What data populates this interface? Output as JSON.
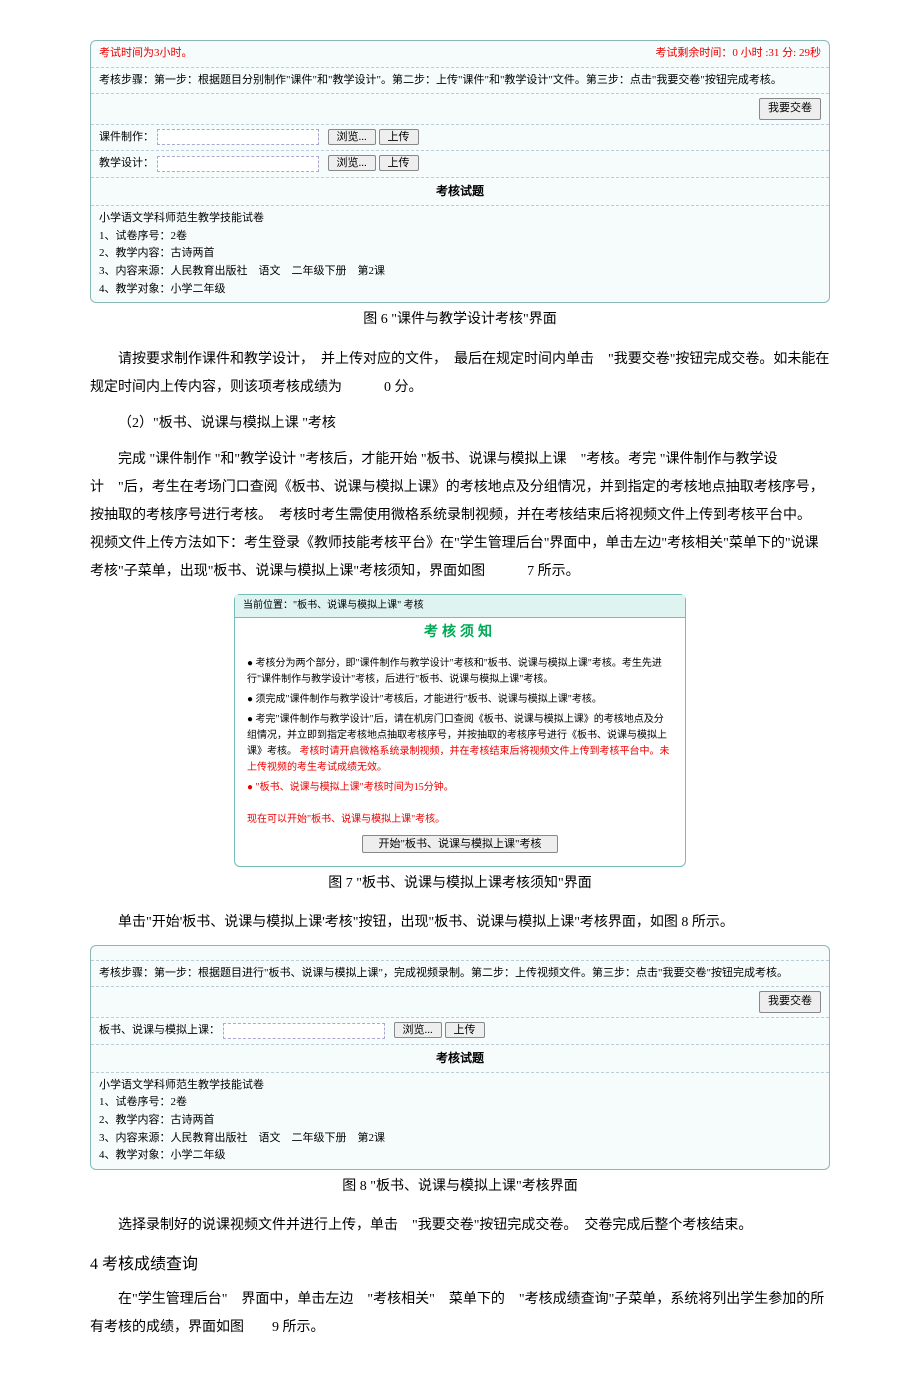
{
  "fig6": {
    "timer_left": "考试时间为3小时。",
    "timer_right": "考试剩余时间：0 小时 :31 分: 29秒",
    "steps": "考核步骤：第一步：根据题目分别制作\"课件\"和\"教学设计\"。第二步：上传\"课件\"和\"教学设计\"文件。第三步：点击\"我要交卷\"按钮完成考核。",
    "submit": "我要交卷",
    "row1_label": "课件制作：",
    "row2_label": "教学设计：",
    "browse": "浏览...",
    "upload": "上传",
    "section": "考核试题",
    "papertitle": "小学语文学科师范生教学技能试卷",
    "i1": "1、试卷序号：2卷",
    "i2": "2、教学内容：古诗两首",
    "i3": "3、内容来源：人民教育出版社　语文　二年级下册　第2课",
    "i4": "4、教学对象：小学二年级",
    "caption": "图 6 \"课件与教学设计考核\"界面"
  },
  "p1": "请按要求制作课件和教学设计，　并上传对应的文件，　最后在规定时间内单击　\"我要交卷\"按钮完成交卷。如未能在规定时间内上传内容，则该项考核成绩为　　　0 分。",
  "p2_label": "（2）\"板书、说课与模拟上课 \"考核",
  "p3": "完成 \"课件制作 \"和\"教学设计 \"考核后，才能开始 \"板书、说课与模拟上课　\"考核。考完 \"课件制作与教学设计　\"后，考生在考场门口查阅《板书、说课与模拟上课》的考核地点及分组情况，并到指定的考核地点抽取考核序号，　按抽取的考核序号进行考核。　考核时考生需使用微格系统录制视频，并在考核结束后将视频文件上传到考核平台中。　视频文件上传方法如下：考生登录《教师技能考核平台》在\"学生管理后台\"界面中，单击左边\"考核相关\"菜单下的\"说课考核\"子菜单，出现\"板书、说课与模拟上课\"考核须知，界面如图　　　7 所示。",
  "fig7": {
    "head": "当前位置：\"板书、说课与模拟上课\" 考核",
    "title": "考核须知",
    "b1": "● 考核分为两个部分，即\"课件制作与教学设计\"考核和\"板书、说课与模拟上课\"考核。考生先进行\"课件制作与教学设计\"考核，后进行\"板书、说课与模拟上课\"考核。",
    "b2": "● 须完成\"课件制作与教学设计\"考核后，才能进行\"板书、说课与模拟上课\"考核。",
    "b3a": "● 考完\"课件制作与教学设计\"后，请在机房门口查阅《板书、说课与模拟上课》的考核地点及分组情况，并立即到指定考核地点抽取考核序号，并按抽取的考核序号进行《板书、说课与模拟上课》考核。",
    "b3b": "考核时请开启微格系统录制视频，并在考核结束后将视频文件上传到考核平台中。未上传视频的考生考试成绩无效。",
    "b4": "● \"板书、说课与模拟上课\"考核时间为15分钟。",
    "ready": "现在可以开始\"板书、说课与模拟上课\"考核。",
    "btn": "开始\"板书、说课与模拟上课\"考核",
    "caption": "图 7 \"板书、说课与模拟上课考核须知\"界面"
  },
  "p4": "单击\"开始'板书、说课与模拟上课'考核\"按钮，出现\"板书、说课与模拟上课\"考核界面，如图 8 所示。",
  "fig8": {
    "steps": "考核步骤：第一步：根据题目进行\"板书、说课与模拟上课\"，完成视频录制。第二步：上传视频文件。第三步：点击\"我要交卷\"按钮完成考核。",
    "submit": "我要交卷",
    "row_label": "板书、说课与模拟上课：",
    "browse": "浏览...",
    "upload": "上传",
    "section": "考核试题",
    "papertitle": "小学语文学科师范生教学技能试卷",
    "i1": "1、试卷序号：2卷",
    "i2": "2、教学内容：古诗两首",
    "i3": "3、内容来源：人民教育出版社　语文　二年级下册　第2课",
    "i4": "4、教学对象：小学二年级",
    "caption": "图 8 \"板书、说课与模拟上课\"考核界面"
  },
  "p5": "选择录制好的说课视频文件并进行上传，单击　\"我要交卷\"按钮完成交卷。　交卷完成后整个考核结束。",
  "h2": "4  考核成绩查询",
  "p6": "在\"学生管理后台\"　界面中，单击左边　\"考核相关\"　菜单下的　\"考核成绩查询\"子菜单，系统将列出学生参加的所有考核的成绩，界面如图　　9 所示。"
}
